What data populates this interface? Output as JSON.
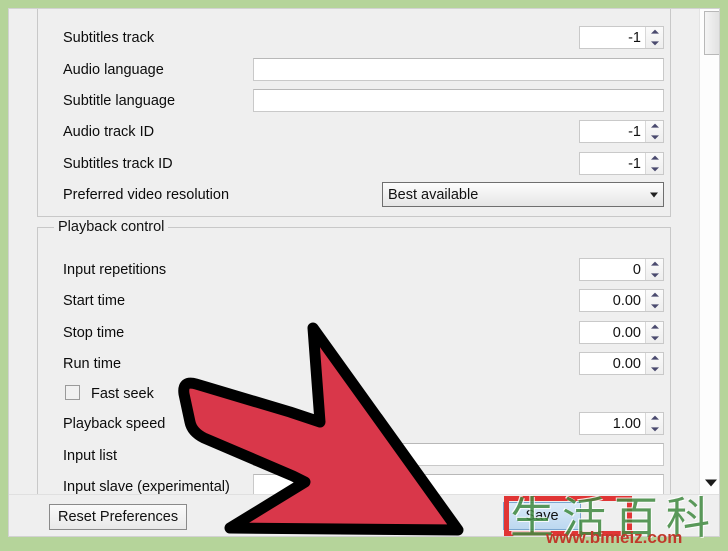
{
  "app": {
    "frame_color": "#b5d49a",
    "dialog_bg": "#efefef",
    "accent_red": "#e03535",
    "arrow_fill": "#d9374a",
    "arrow_stroke": "#000000"
  },
  "groups": [
    {
      "id": "subtitles",
      "title": "",
      "rows": [
        {
          "label": "Subtitles track",
          "control": "spin",
          "value": "-1"
        },
        {
          "label": "Audio language",
          "control": "text",
          "value": ""
        },
        {
          "label": "Subtitle language",
          "control": "text",
          "value": ""
        },
        {
          "label": "Audio track ID",
          "control": "spin",
          "value": "-1"
        },
        {
          "label": "Subtitles track ID",
          "control": "spin",
          "value": "-1"
        },
        {
          "label": "Preferred video resolution",
          "control": "combo",
          "value": "Best available"
        }
      ]
    },
    {
      "id": "playback",
      "title": "Playback control",
      "rows": [
        {
          "label": "Input repetitions",
          "control": "spin",
          "value": "0"
        },
        {
          "label": "Start time",
          "control": "spin",
          "value": "0.00"
        },
        {
          "label": "Stop time",
          "control": "spin",
          "value": "0.00"
        },
        {
          "label": "Run time",
          "control": "spin",
          "value": "0.00"
        },
        {
          "label": "Fast seek",
          "control": "checkbox",
          "value": "unchecked"
        },
        {
          "label": "Playback speed",
          "control": "spin",
          "value": "1.00"
        },
        {
          "label": "Input list",
          "control": "text",
          "value": ""
        },
        {
          "label": "Input slave (experimental)",
          "control": "text",
          "value": ""
        }
      ]
    }
  ],
  "labels": {
    "subtitles_track": "Subtitles track",
    "audio_language": "Audio language",
    "subtitle_language": "Subtitle language",
    "audio_track_id": "Audio track ID",
    "subtitles_track_id": "Subtitles track ID",
    "preferred_video_resolution": "Preferred video resolution",
    "playback_control": "Playback control",
    "input_repetitions": "Input repetitions",
    "start_time": "Start time",
    "stop_time": "Stop time",
    "run_time": "Run time",
    "fast_seek": "Fast seek",
    "playback_speed": "Playback speed",
    "input_list": "Input list",
    "input_slave": "Input slave (experimental)"
  },
  "values": {
    "subtitles_track": "-1",
    "audio_language": "",
    "subtitle_language": "",
    "audio_track_id": "-1",
    "subtitles_track_id": "-1",
    "preferred_video_resolution": "Best available",
    "input_repetitions": "0",
    "start_time": "0.00",
    "stop_time": "0.00",
    "run_time": "0.00",
    "playback_speed": "1.00",
    "input_list": "",
    "input_slave": ""
  },
  "buttons": {
    "reset": "Reset Preferences",
    "save": "Save"
  },
  "watermark": {
    "cjk": "生活百科",
    "url": "www.bimeiz.com"
  },
  "icons": {
    "spinner_up": "chevron-up-icon",
    "spinner_down": "chevron-down-icon",
    "combo_arrow": "chevron-down-icon",
    "scroll_down": "scroll-down-arrow-icon",
    "pointer": "red-arrow-pointer-icon"
  }
}
